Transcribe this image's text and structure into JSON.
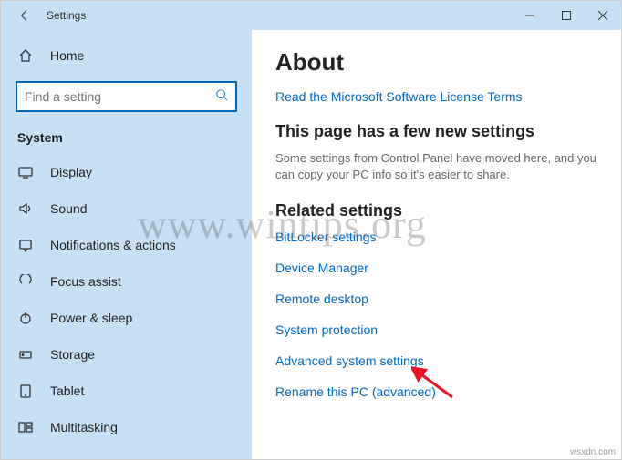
{
  "window": {
    "title": "Settings"
  },
  "search": {
    "placeholder": "Find a setting"
  },
  "sidebar": {
    "home": "Home",
    "section": "System",
    "items": [
      {
        "label": "Display"
      },
      {
        "label": "Sound"
      },
      {
        "label": "Notifications & actions"
      },
      {
        "label": "Focus assist"
      },
      {
        "label": "Power & sleep"
      },
      {
        "label": "Storage"
      },
      {
        "label": "Tablet"
      },
      {
        "label": "Multitasking"
      }
    ]
  },
  "main": {
    "heading": "About",
    "license_link": "Read the Microsoft Software License Terms",
    "new_settings_heading": "This page has a few new settings",
    "new_settings_body": "Some settings from Control Panel have moved here, and you can copy your PC info so it's easier to share.",
    "related_heading": "Related settings",
    "related": [
      "BitLocker settings",
      "Device Manager",
      "Remote desktop",
      "System protection",
      "Advanced system settings",
      "Rename this PC (advanced)"
    ]
  },
  "watermark": "www.wintips.org",
  "attribution": "wsxdn.com"
}
